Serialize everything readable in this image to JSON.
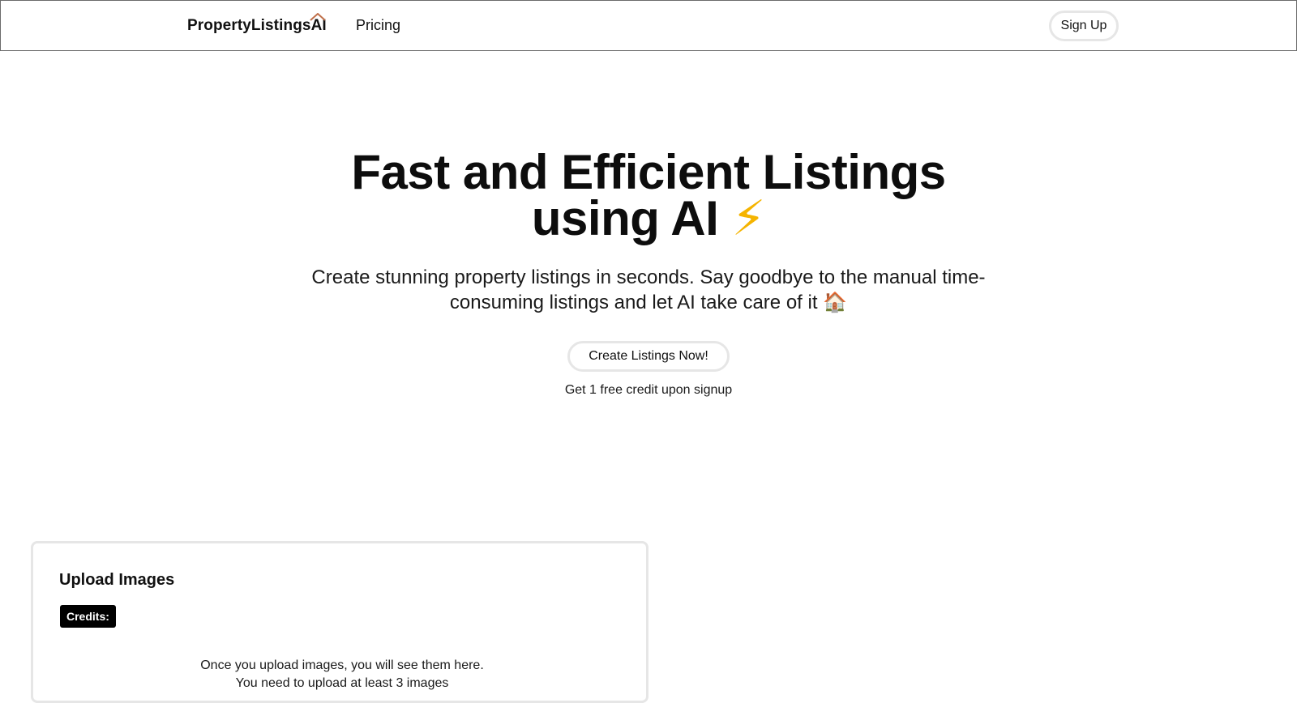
{
  "nav": {
    "brand": "PropertyListingsAI",
    "pricing_label": "Pricing",
    "signup_label": "Sign Up"
  },
  "hero": {
    "title_line1": "Fast and Efficient Listings",
    "title_line2": "using AI",
    "title_emoji": "⚡",
    "subtitle": "Create stunning property listings in seconds. Say goodbye to the manual time-consuming listings and let AI take care of it",
    "subtitle_emoji": "🏠",
    "cta_label": "Create Listings Now!",
    "cta_note": "Get 1 free credit upon signup"
  },
  "upload": {
    "title": "Upload Images",
    "credits_label": "Credits:",
    "empty_line1": "Once you upload images, you will see them here.",
    "empty_line2": "You need to upload at least 3 images"
  },
  "colors": {
    "accent": "#000000",
    "border": "#e6e6e6",
    "roof": "#c0704a"
  }
}
